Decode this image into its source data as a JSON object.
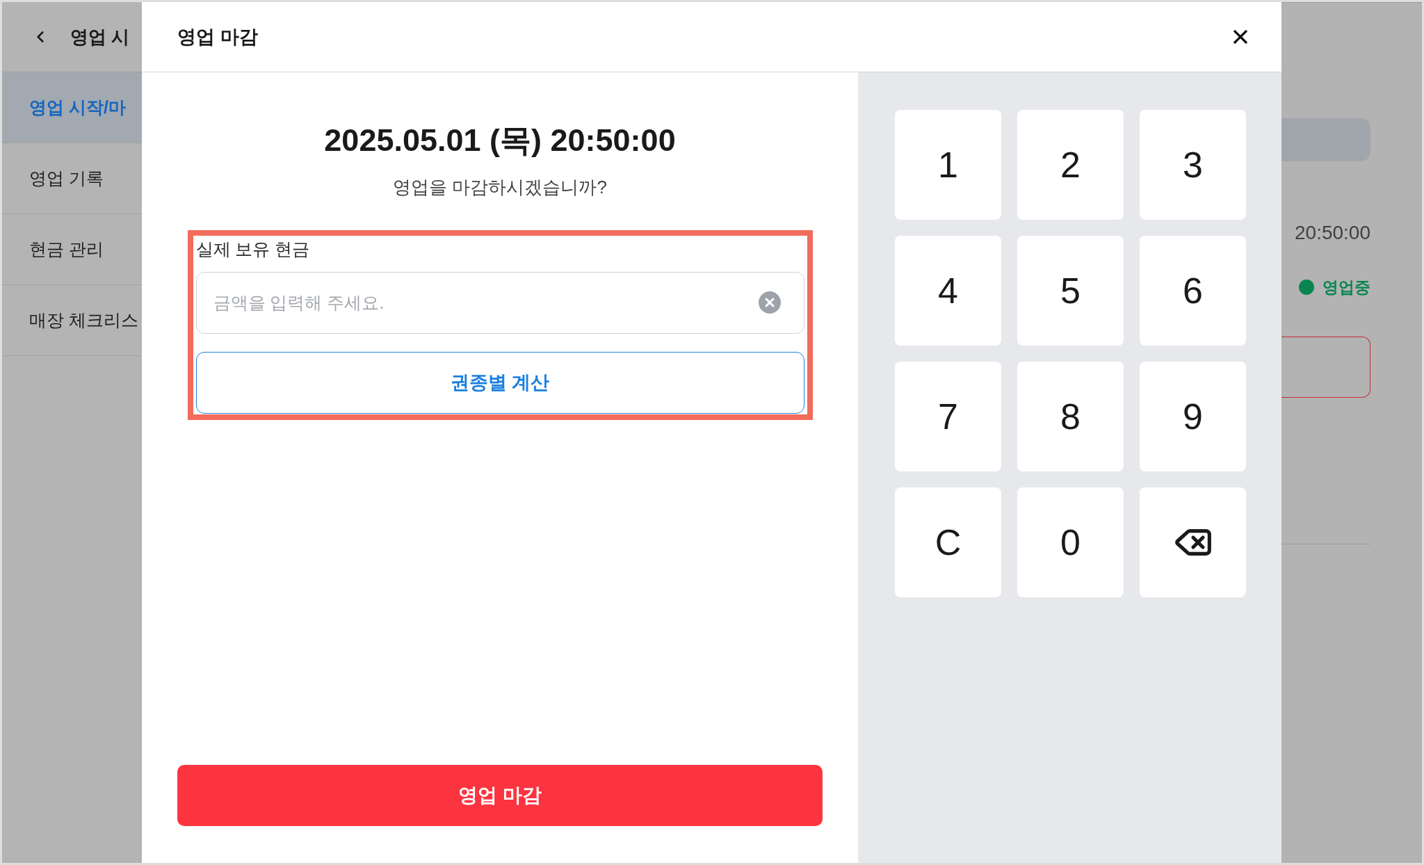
{
  "app_header": {
    "title": "영업 시"
  },
  "sidebar": {
    "items": [
      {
        "label": "영업 시작/마",
        "selected": true
      },
      {
        "label": "영업 기록",
        "selected": false
      },
      {
        "label": "현금 관리",
        "selected": false
      },
      {
        "label": "매장 체크리스",
        "selected": false
      }
    ]
  },
  "background_panel": {
    "time": "20:50:00",
    "status": {
      "label": "영업중",
      "color": "#0a8550"
    }
  },
  "modal": {
    "title": "영업 마감",
    "datetime": "2025.05.01 (목) 20:50:00",
    "question": "영업을 마감하시겠습니까?",
    "cash_section": {
      "highlighted": true,
      "label": "실제 보유 현금",
      "placeholder": "금액을 입력해 주세요.",
      "calc_button": "권종별 계산"
    },
    "submit_button": "영업 마감",
    "keypad": [
      {
        "kind": "key",
        "label": "1"
      },
      {
        "kind": "key",
        "label": "2"
      },
      {
        "kind": "key",
        "label": "3"
      },
      {
        "kind": "key",
        "label": "4"
      },
      {
        "kind": "key",
        "label": "5"
      },
      {
        "kind": "key",
        "label": "6"
      },
      {
        "kind": "key",
        "label": "7"
      },
      {
        "kind": "key",
        "label": "8"
      },
      {
        "kind": "key",
        "label": "9"
      },
      {
        "kind": "key",
        "label": "C"
      },
      {
        "kind": "key",
        "label": "0"
      },
      {
        "kind": "backspace"
      }
    ]
  }
}
